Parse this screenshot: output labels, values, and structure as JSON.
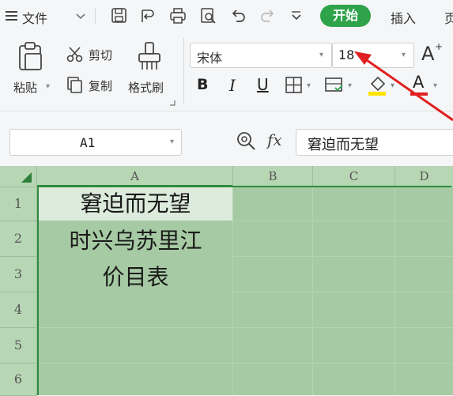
{
  "menubar": {
    "file_label": "文件",
    "start_tab": "开始",
    "insert_tab": "插入",
    "next_tab_partial": "页"
  },
  "clipboard": {
    "paste_label": "粘贴",
    "cut_label": "剪切",
    "copy_label": "复制",
    "format_painter_label": "格式刷"
  },
  "font": {
    "name": "宋体",
    "size": "18",
    "bold": "B",
    "italic": "I",
    "underline": "U",
    "grow_glyph": "A",
    "font_color_glyph": "A"
  },
  "formula_bar": {
    "name_box": "A1",
    "fx_label": "fx",
    "content": "窘迫而无望"
  },
  "sheet": {
    "columns": [
      "A",
      "B",
      "C",
      "D"
    ],
    "rows": [
      "1",
      "2",
      "3",
      "4",
      "5",
      "6"
    ],
    "a1_text": "窘迫而无望",
    "merged_line2": "时兴乌苏里江",
    "merged_line3": "价目表"
  },
  "colors": {
    "accent_green": "#2ea34a",
    "arrow_red": "#e02020",
    "selection_fill": "#a6caa3"
  }
}
